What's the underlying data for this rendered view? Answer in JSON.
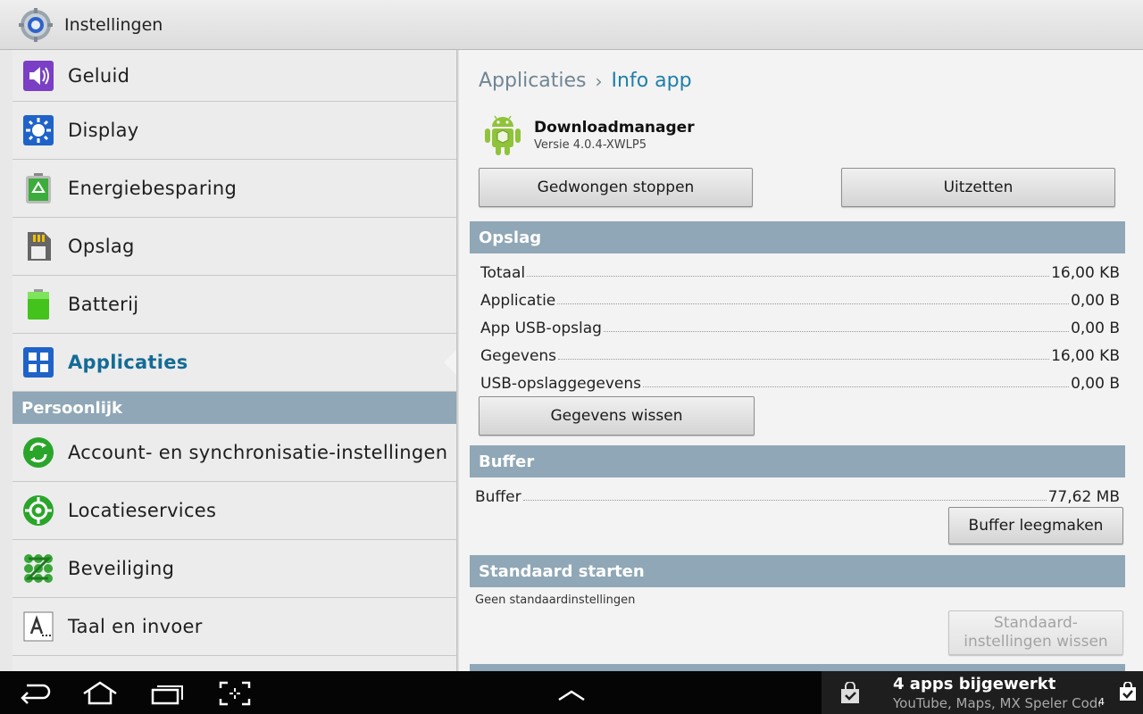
{
  "titlebar": {
    "title": "Instellingen",
    "icon": "settings-gear-icon"
  },
  "sidebar": {
    "items": [
      {
        "label": "Geluid",
        "icon": "sound-icon"
      },
      {
        "label": "Display",
        "icon": "display-icon"
      },
      {
        "label": "Energiebesparing",
        "icon": "power-saving-icon"
      },
      {
        "label": "Opslag",
        "icon": "storage-icon"
      },
      {
        "label": "Batterij",
        "icon": "battery-icon"
      },
      {
        "label": "Applicaties",
        "icon": "apps-icon",
        "active": true
      }
    ],
    "section": "Persoonlijk",
    "personal_items": [
      {
        "label": "Account- en synchronisatie-instellingen",
        "icon": "sync-icon"
      },
      {
        "label": "Locatieservices",
        "icon": "location-icon"
      },
      {
        "label": "Beveiliging",
        "icon": "security-icon"
      },
      {
        "label": "Taal en invoer",
        "icon": "language-icon"
      }
    ]
  },
  "main": {
    "breadcrumb": {
      "parent": "Applicaties",
      "separator": "›",
      "current": "Info app"
    },
    "app": {
      "name": "Downloadmanager",
      "version": "Versie 4.0.4-XWLP5",
      "icon": "android-icon"
    },
    "buttons": {
      "force_stop": "Gedwongen stoppen",
      "disable": "Uitzetten"
    },
    "storage": {
      "title": "Opslag",
      "rows": [
        {
          "label": "Totaal",
          "value": "16,00 KB"
        },
        {
          "label": "Applicatie",
          "value": "0,00 B"
        },
        {
          "label": "App USB-opslag",
          "value": "0,00 B"
        },
        {
          "label": "Gegevens",
          "value": "16,00 KB"
        },
        {
          "label": "USB-opslaggegevens",
          "value": "0,00 B"
        }
      ],
      "clear_data": "Gegevens wissen"
    },
    "cache": {
      "title": "Buffer",
      "label": "Buffer",
      "value": "77,62 MB",
      "clear_cache": "Buffer leegmaken"
    },
    "launch": {
      "title": "Standaard starten",
      "note": "Geen standaardinstellingen",
      "clear_defaults_line1": "Standaard-",
      "clear_defaults_line2": "instellingen wissen"
    }
  },
  "navbar": {
    "notification": {
      "title": "4 apps bijgewerkt",
      "subtitle": "YouTube, Maps, MX Speler Codec",
      "count": "4"
    }
  },
  "colors": {
    "section": "#8fa7b6",
    "accent": "#146b96",
    "navbar": "#050505"
  }
}
